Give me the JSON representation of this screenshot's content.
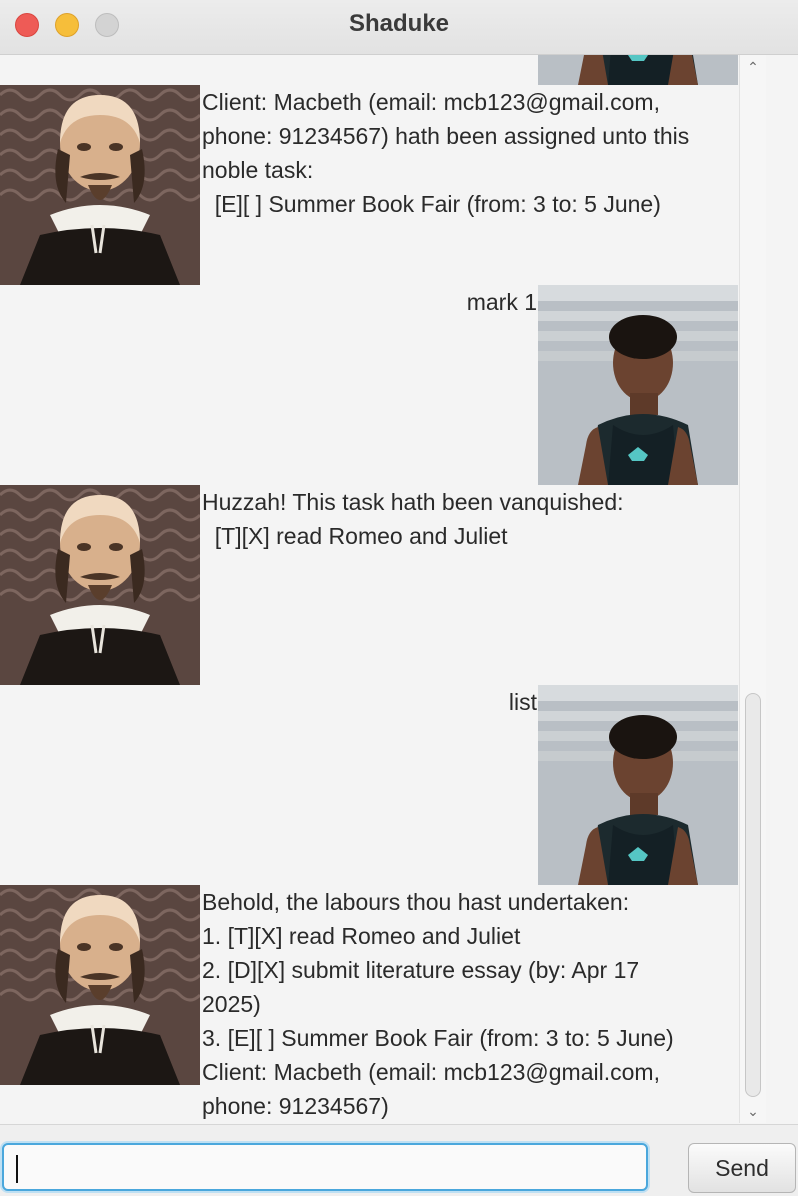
{
  "window": {
    "title": "Shaduke"
  },
  "messages": [
    {
      "sender": "bot",
      "text": "Client: Macbeth (email: mcb123@gmail.com,\nphone: 91234567) hath been assigned unto this\nnoble task:\n  [E][ ] Summer Book Fair (from: 3 to: 5 June)"
    },
    {
      "sender": "user",
      "text": "mark 1"
    },
    {
      "sender": "bot",
      "text": "Huzzah! This task hath been vanquished:\n  [T][X] read Romeo and Juliet"
    },
    {
      "sender": "user",
      "text": "list"
    },
    {
      "sender": "bot",
      "text": "Behold, the labours thou hast undertaken:\n1. [T][X] read Romeo and Juliet\n2. [D][X] submit literature essay (by: Apr 17\n2025)\n3. [E][ ] Summer Book Fair (from: 3 to: 5 June)\nClient: Macbeth (email: mcb123@gmail.com,\nphone: 91234567)"
    }
  ],
  "input": {
    "value": "",
    "placeholder": ""
  },
  "send_button": {
    "label": "Send"
  },
  "icons": {
    "bot_avatar": "shakespeare-portrait-icon",
    "user_avatar": "user-photo-icon",
    "scroll_up": "chevron-up-icon",
    "scroll_down": "chevron-down-icon"
  },
  "colors": {
    "close": "#ee5b56",
    "minimize": "#f6be3a",
    "maximize": "#d3d3d3",
    "input_focus": "#4aa7dc"
  }
}
